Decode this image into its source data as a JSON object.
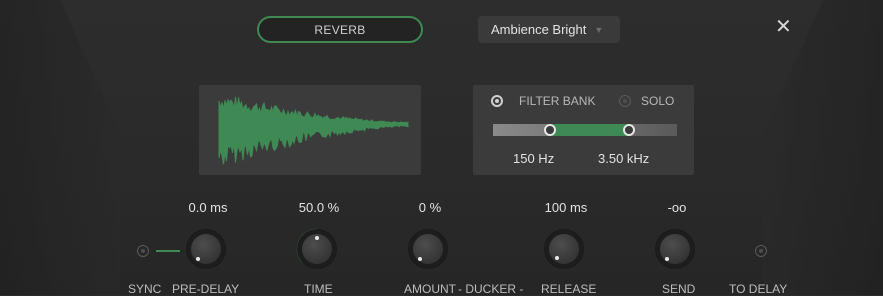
{
  "header": {
    "module_label": "REVERB",
    "preset_name": "Ambience Bright",
    "close_glyph": "✕"
  },
  "filter": {
    "filter_bank_label": "FILTER BANK",
    "solo_label": "SOLO",
    "filter_bank_on": true,
    "solo_on": false,
    "low_freq": "150 Hz",
    "high_freq": "3.50 kHz"
  },
  "controls": {
    "pre_delay": {
      "label": "PRE-DELAY",
      "value": "0.0 ms"
    },
    "time": {
      "label": "TIME",
      "value": "50.0 %"
    },
    "amount": {
      "label": "AMOUNT",
      "value": "0 %"
    },
    "ducker": {
      "label": "- DUCKER -"
    },
    "release": {
      "label": "RELEASE",
      "value": "100 ms"
    },
    "send": {
      "label": "SEND",
      "value": "-oo"
    },
    "sync": {
      "label": "SYNC"
    },
    "to_delay": {
      "label": "TO DELAY"
    }
  },
  "colors": {
    "accent": "#3f8a54",
    "background": "#2b2b2b",
    "display_bg": "#3b3b3b"
  }
}
